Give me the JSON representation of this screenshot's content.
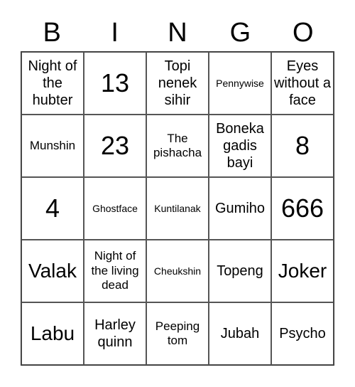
{
  "header": [
    "B",
    "I",
    "N",
    "G",
    "O"
  ],
  "cells": [
    {
      "text": "Night of the hubter",
      "size": "md"
    },
    {
      "text": "13",
      "size": "xl"
    },
    {
      "text": "Topi nenek sihir",
      "size": "md"
    },
    {
      "text": "Pennywise",
      "size": "xs"
    },
    {
      "text": "Eyes without a face",
      "size": "md"
    },
    {
      "text": "Munshin",
      "size": "sm"
    },
    {
      "text": "23",
      "size": "xl"
    },
    {
      "text": "The pishacha",
      "size": "sm"
    },
    {
      "text": "Boneka gadis bayi",
      "size": "md"
    },
    {
      "text": "8",
      "size": "xl"
    },
    {
      "text": "4",
      "size": "xl"
    },
    {
      "text": "Ghostface",
      "size": "xs"
    },
    {
      "text": "Kuntilanak",
      "size": "xs"
    },
    {
      "text": "Gumiho",
      "size": "md"
    },
    {
      "text": "666",
      "size": "xl"
    },
    {
      "text": "Valak",
      "size": "lg"
    },
    {
      "text": "Night of the living dead",
      "size": "sm"
    },
    {
      "text": "Cheukshin",
      "size": "xs"
    },
    {
      "text": "Topeng",
      "size": "md"
    },
    {
      "text": "Joker",
      "size": "lg"
    },
    {
      "text": "Labu",
      "size": "lg"
    },
    {
      "text": "Harley quinn",
      "size": "md"
    },
    {
      "text": "Peeping tom",
      "size": "sm"
    },
    {
      "text": "Jubah",
      "size": "md"
    },
    {
      "text": "Psycho",
      "size": "md"
    }
  ]
}
